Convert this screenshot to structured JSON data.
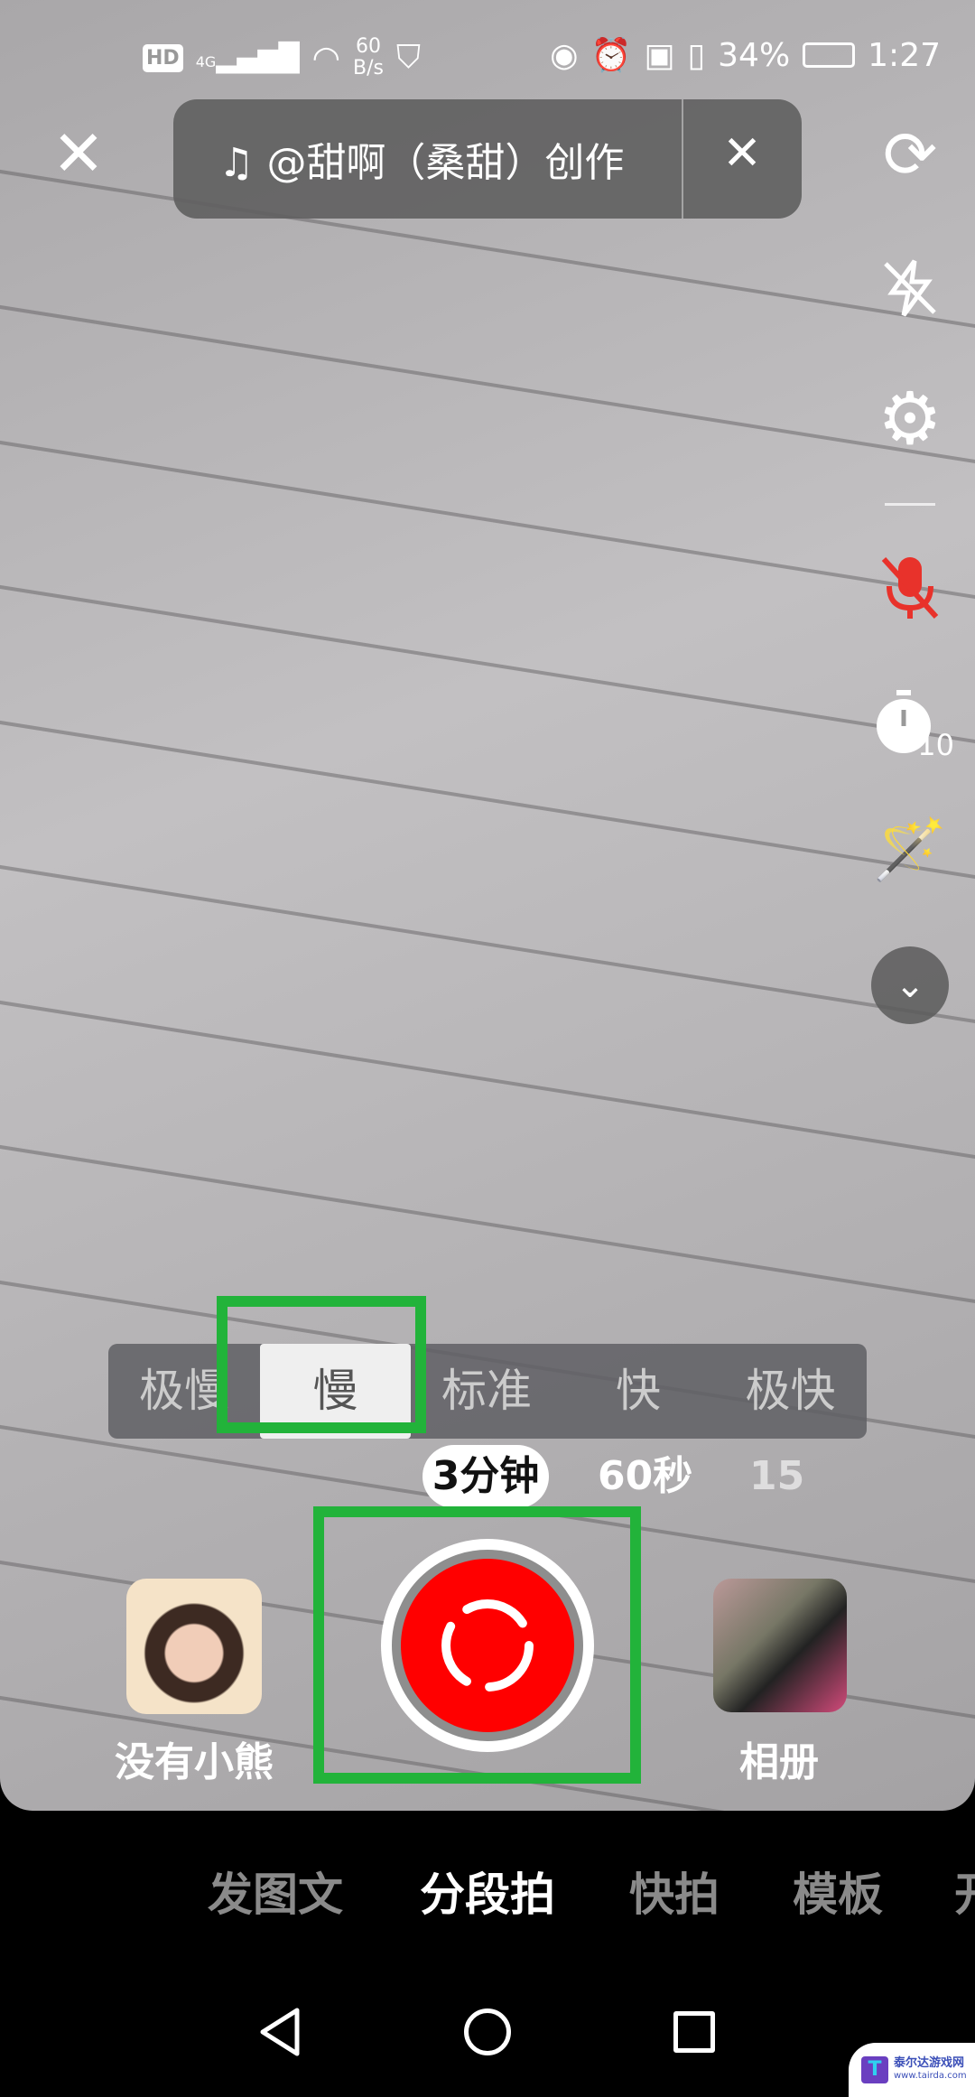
{
  "status_bar": {
    "network": "4G",
    "speed_value": "60",
    "speed_unit": "B/s",
    "battery": "34%",
    "time": "1:27",
    "hd": "HD"
  },
  "music": {
    "icon": "music-note-icon",
    "label": "@甜啊（桑甜）创作"
  },
  "right_toolbar": [
    "flip-camera-icon",
    "flash-off-icon",
    "settings-icon",
    "mic-off-icon",
    "timer-10-icon",
    "beauty-wand-icon",
    "expand-more-icon"
  ],
  "timer_value": "10",
  "speed_options": [
    "极慢",
    "慢",
    "标准",
    "快",
    "极快"
  ],
  "selected_speed": "慢",
  "durations": [
    "3分钟",
    "60秒",
    "15"
  ],
  "selected_duration": "3分钟",
  "effect_label": "没有小熊",
  "album_label": "相册",
  "mode_tabs": [
    "发图文",
    "分段拍",
    "快拍",
    "模板",
    "开"
  ],
  "selected_mode": "分段拍",
  "colors": {
    "record": "#ff0000",
    "highlight": "#22b33a",
    "mic_off": "#e8322b"
  },
  "watermark": {
    "name": "泰尔达游戏网",
    "url": "www.tairda.com"
  }
}
